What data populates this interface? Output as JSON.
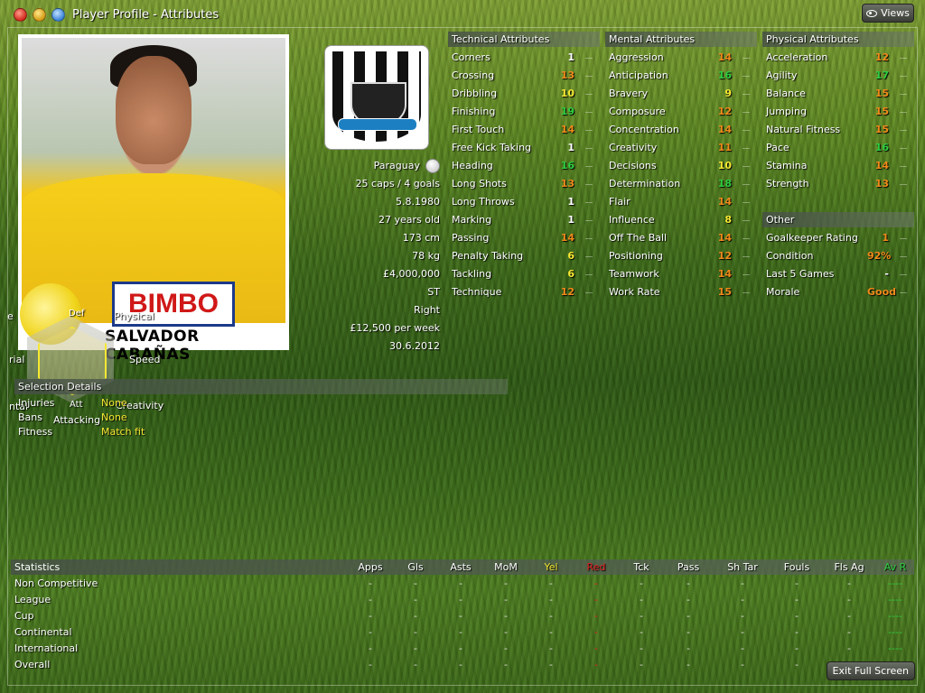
{
  "window": {
    "title": "Player Profile - Attributes",
    "views_label": "Views"
  },
  "player": {
    "name": "SALVADOR CABAÑAS",
    "sponsor": "BIMBO",
    "nationality": "Paraguay",
    "caps": "25 caps / 4 goals",
    "dob": "5.8.1980",
    "age": "27 years old",
    "height": "173 cm",
    "weight": "78 kg",
    "value": "£4,000,000",
    "position": "ST",
    "foot": "Right",
    "wage": "£12,500 per week",
    "contract": "30.6.2012"
  },
  "technical": {
    "header": "Technical Attributes",
    "items": [
      {
        "name": "Corners",
        "value": "1",
        "color": "#ffffff"
      },
      {
        "name": "Crossing",
        "value": "13",
        "color": "#f08a1a"
      },
      {
        "name": "Dribbling",
        "value": "10",
        "color": "#f6e832"
      },
      {
        "name": "Finishing",
        "value": "19",
        "color": "#2ecc40"
      },
      {
        "name": "First Touch",
        "value": "14",
        "color": "#f08a1a"
      },
      {
        "name": "Free Kick Taking",
        "value": "1",
        "color": "#ffffff"
      },
      {
        "name": "Heading",
        "value": "16",
        "color": "#2ecc40"
      },
      {
        "name": "Long Shots",
        "value": "13",
        "color": "#f08a1a"
      },
      {
        "name": "Long Throws",
        "value": "1",
        "color": "#ffffff"
      },
      {
        "name": "Marking",
        "value": "1",
        "color": "#ffffff"
      },
      {
        "name": "Passing",
        "value": "14",
        "color": "#f08a1a"
      },
      {
        "name": "Penalty Taking",
        "value": "6",
        "color": "#f6e832"
      },
      {
        "name": "Tackling",
        "value": "6",
        "color": "#f6e832"
      },
      {
        "name": "Technique",
        "value": "12",
        "color": "#f08a1a"
      }
    ]
  },
  "mental": {
    "header": "Mental Attributes",
    "items": [
      {
        "name": "Aggression",
        "value": "14",
        "color": "#f08a1a"
      },
      {
        "name": "Anticipation",
        "value": "16",
        "color": "#2ecc40"
      },
      {
        "name": "Bravery",
        "value": "9",
        "color": "#f6e832"
      },
      {
        "name": "Composure",
        "value": "12",
        "color": "#f08a1a"
      },
      {
        "name": "Concentration",
        "value": "14",
        "color": "#f08a1a"
      },
      {
        "name": "Creativity",
        "value": "11",
        "color": "#f08a1a"
      },
      {
        "name": "Decisions",
        "value": "10",
        "color": "#f6e832"
      },
      {
        "name": "Determination",
        "value": "18",
        "color": "#2ecc40"
      },
      {
        "name": "Flair",
        "value": "14",
        "color": "#f08a1a"
      },
      {
        "name": "Influence",
        "value": "8",
        "color": "#f6e832"
      },
      {
        "name": "Off The Ball",
        "value": "14",
        "color": "#f08a1a"
      },
      {
        "name": "Positioning",
        "value": "12",
        "color": "#f08a1a"
      },
      {
        "name": "Teamwork",
        "value": "14",
        "color": "#f08a1a"
      },
      {
        "name": "Work Rate",
        "value": "15",
        "color": "#f08a1a"
      }
    ]
  },
  "physical": {
    "header": "Physical Attributes",
    "items": [
      {
        "name": "Acceleration",
        "value": "12",
        "color": "#f08a1a"
      },
      {
        "name": "Agility",
        "value": "17",
        "color": "#2ecc40"
      },
      {
        "name": "Balance",
        "value": "15",
        "color": "#f08a1a"
      },
      {
        "name": "Jumping",
        "value": "15",
        "color": "#f08a1a"
      },
      {
        "name": "Natural Fitness",
        "value": "15",
        "color": "#f08a1a"
      },
      {
        "name": "Pace",
        "value": "16",
        "color": "#2ecc40"
      },
      {
        "name": "Stamina",
        "value": "14",
        "color": "#f08a1a"
      },
      {
        "name": "Strength",
        "value": "13",
        "color": "#f08a1a"
      }
    ]
  },
  "other": {
    "header": "Other",
    "items": [
      {
        "name": "Goalkeeper Rating",
        "value": "1",
        "color": "#f08a1a"
      },
      {
        "name": "Condition",
        "value": "92%",
        "color": "#f08a1a"
      },
      {
        "name": "Last 5 Games",
        "value": "-",
        "color": "#ffffff"
      },
      {
        "name": "Morale",
        "value": "Good",
        "color": "#f08a1a"
      }
    ]
  },
  "overlay_labels": {
    "def": "Def",
    "physical": "Physical",
    "speed": "Speed",
    "att": "Att",
    "attacking": "Attacking",
    "creativity": "Creativity",
    "left1": "e",
    "left2": "rial",
    "left3": "ntal"
  },
  "selection": {
    "header": "Selection Details",
    "rows": [
      {
        "label": "Injuries",
        "value": "None"
      },
      {
        "label": "Bans",
        "value": "None"
      },
      {
        "label": "Fitness",
        "value": "Match fit"
      }
    ]
  },
  "stats": {
    "title": "Statistics",
    "columns": [
      "Apps",
      "Gls",
      "Asts",
      "MoM",
      "Yel",
      "Red",
      "Tck",
      "Pass",
      "Sh Tar",
      "Fouls",
      "Fls Ag",
      "Av R"
    ],
    "column_colors": [
      "#ffffff",
      "#ffffff",
      "#ffffff",
      "#ffffff",
      "#f6e832",
      "#e02020",
      "#ffffff",
      "#ffffff",
      "#ffffff",
      "#ffffff",
      "#ffffff",
      "#2ecc40"
    ],
    "rows": [
      {
        "label": "Non Competitive",
        "cells": [
          "-",
          "-",
          "-",
          "-",
          "-",
          "-",
          "-",
          "-",
          "-",
          "-",
          "-",
          "----"
        ]
      },
      {
        "label": "League",
        "cells": [
          "-",
          "-",
          "-",
          "-",
          "-",
          "-",
          "-",
          "-",
          "-",
          "-",
          "-",
          "----"
        ]
      },
      {
        "label": "Cup",
        "cells": [
          "-",
          "-",
          "-",
          "-",
          "-",
          "-",
          "-",
          "-",
          "-",
          "-",
          "-",
          "----"
        ]
      },
      {
        "label": "Continental",
        "cells": [
          "-",
          "-",
          "-",
          "-",
          "-",
          "-",
          "-",
          "-",
          "-",
          "-",
          "-",
          "----"
        ]
      },
      {
        "label": "International",
        "cells": [
          "-",
          "-",
          "-",
          "-",
          "-",
          "-",
          "-",
          "-",
          "-",
          "-",
          "-",
          "----"
        ]
      },
      {
        "label": "Overall",
        "cells": [
          "-",
          "-",
          "-",
          "-",
          "-",
          "-",
          "-",
          "-",
          "-",
          "-",
          "-",
          "----"
        ]
      }
    ]
  },
  "exit_label": "Exit Full Screen"
}
